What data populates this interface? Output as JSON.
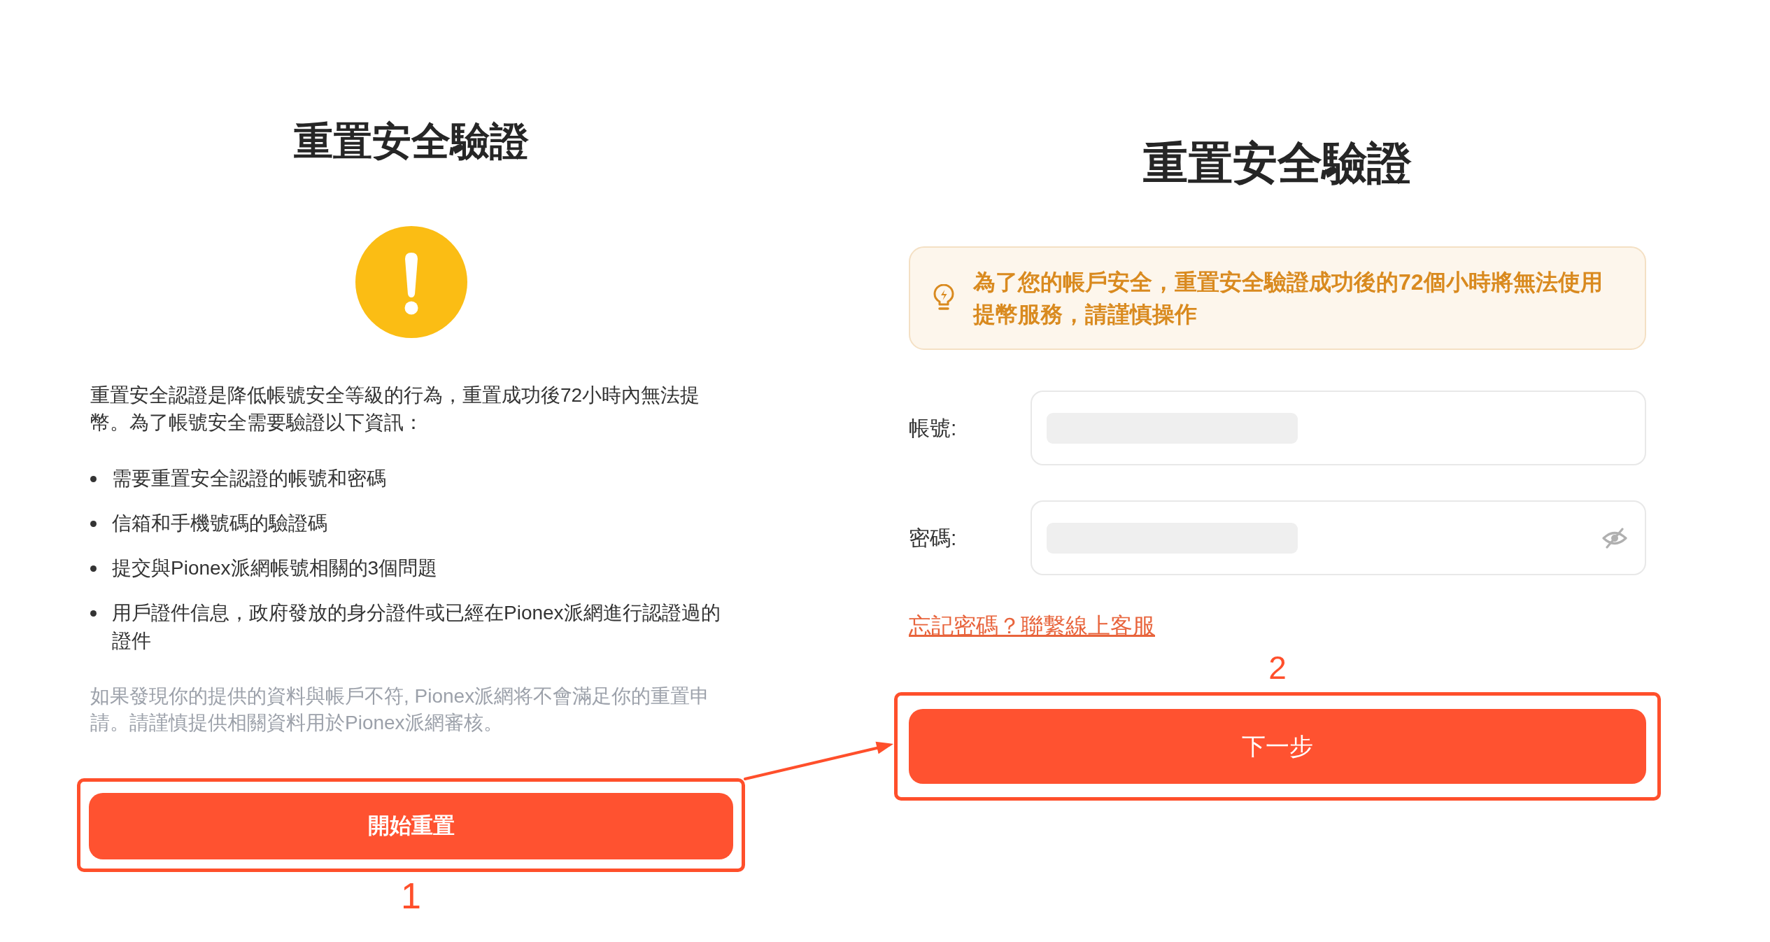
{
  "left_panel": {
    "title": "重置安全驗證",
    "description": "重置安全認證是降低帳號安全等級的行為，重置成功後72小時內無法提幣。為了帳號安全需要驗證以下資訊：",
    "requirements": [
      "需要重置安全認證的帳號和密碼",
      "信箱和手機號碼的驗證碼",
      "提交與Pionex派網帳號相關的3個問題",
      "用戶證件信息，政府發放的身分證件或已經在Pionex派網進行認證過的證件"
    ],
    "note": "如果發現你的提供的資料與帳戶不符, Pionex派網将不會滿足你的重置申請。請謹慎提供相關資料用於Pionex派網審核。",
    "button": {
      "label": "開始重置",
      "highlighted": true
    },
    "step_number": "1"
  },
  "right_panel": {
    "title": "重置安全驗證",
    "notice": "為了您的帳戶安全，重置安全驗證成功後的72個小時將無法使用提幣服務，請謹慎操作",
    "fields": [
      {
        "label": "帳號:",
        "kind": "text",
        "redacted": true
      },
      {
        "label": "密碼:",
        "kind": "password",
        "redacted": true
      }
    ],
    "forgot_link": "忘記密碼？聯繫線上客服",
    "step_number": "2",
    "button": {
      "label": "下一步",
      "highlighted": true
    }
  },
  "step_arrow": true
}
